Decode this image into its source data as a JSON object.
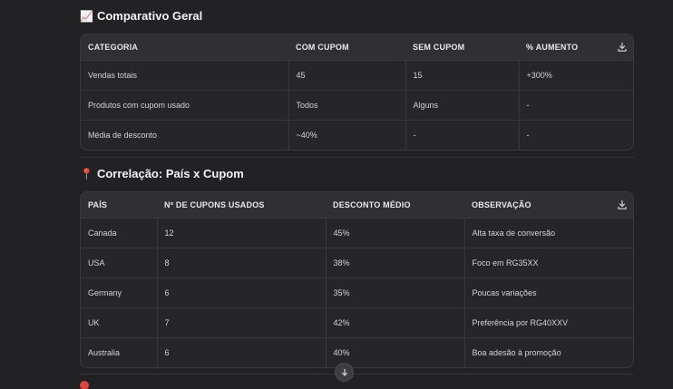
{
  "section1": {
    "emoji": "📈",
    "title": "Comparativo Geral",
    "headers": [
      "CATEGORIA",
      "COM CUPOM",
      "SEM CUPOM",
      "% AUMENTO"
    ],
    "rows": [
      [
        "Vendas totais",
        "45",
        "15",
        "+300%"
      ],
      [
        "Produtos com cupom usado",
        "Todos",
        "Alguns",
        "-"
      ],
      [
        "Média de desconto",
        "~40%",
        "-",
        "-"
      ]
    ]
  },
  "section2": {
    "emoji": "📍",
    "title": "Correlação: País x Cupom",
    "headers": [
      "PAÍS",
      "Nº DE CUPONS USADOS",
      "DESCONTO MÉDIO",
      "OBSERVAÇÃO"
    ],
    "rows": [
      [
        "Canada",
        "12",
        "45%",
        "Alta taxa de conversão"
      ],
      [
        "USA",
        "8",
        "38%",
        "Foco em RG35XX"
      ],
      [
        "Germany",
        "6",
        "35%",
        "Poucas variações"
      ],
      [
        "UK",
        "7",
        "42%",
        "Preferência por RG40XXV"
      ],
      [
        "Australia",
        "6",
        "40%",
        "Boa adesão à promoção"
      ]
    ]
  },
  "icons": {
    "download": "download-icon",
    "scroll_down": "arrow-down-icon"
  }
}
